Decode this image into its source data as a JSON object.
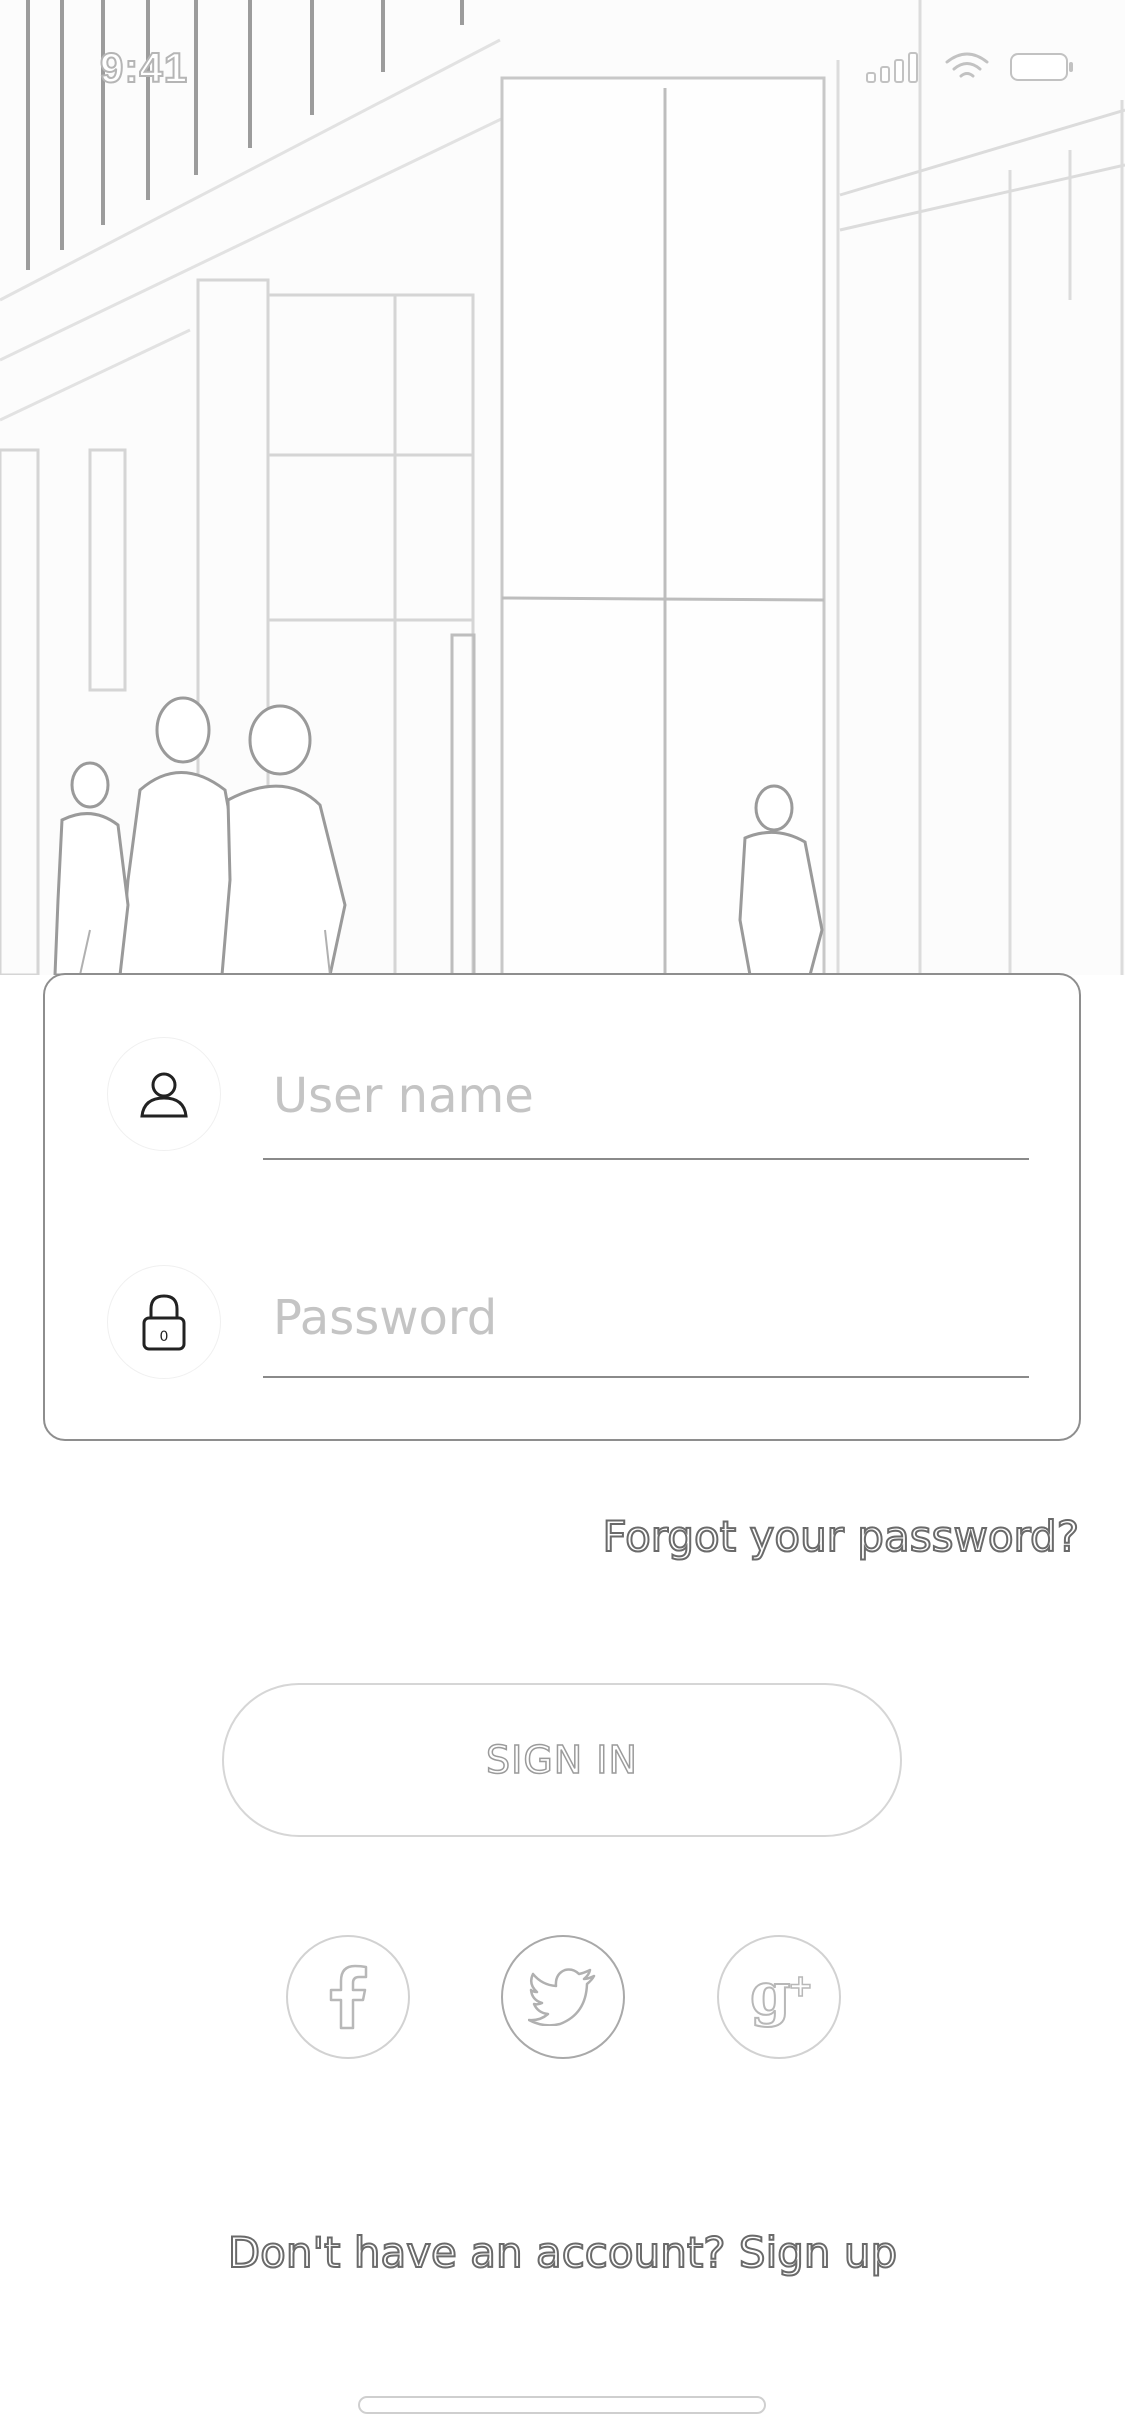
{
  "status_bar": {
    "time": "9:41",
    "icons": [
      "cellular-signal-icon",
      "wifi-icon",
      "battery-icon"
    ]
  },
  "login_form": {
    "username": {
      "placeholder": "User name",
      "value": "",
      "icon": "user-icon"
    },
    "password": {
      "placeholder": "Password",
      "value": "",
      "icon": "lock-icon"
    }
  },
  "forgot_password_label": "Forgot your password?",
  "sign_in_label": "SIGN IN",
  "social_buttons": [
    {
      "name": "facebook",
      "icon": "facebook-icon"
    },
    {
      "name": "twitter",
      "icon": "twitter-icon"
    },
    {
      "name": "google-plus",
      "icon": "google-plus-icon"
    }
  ],
  "signup_prompt": "Don't have an account? Sign up",
  "colors": {
    "background": "#ffffff",
    "card_border": "#8e8e8e",
    "line": "#8a8a8a",
    "placeholder": "#c4c4c4"
  }
}
